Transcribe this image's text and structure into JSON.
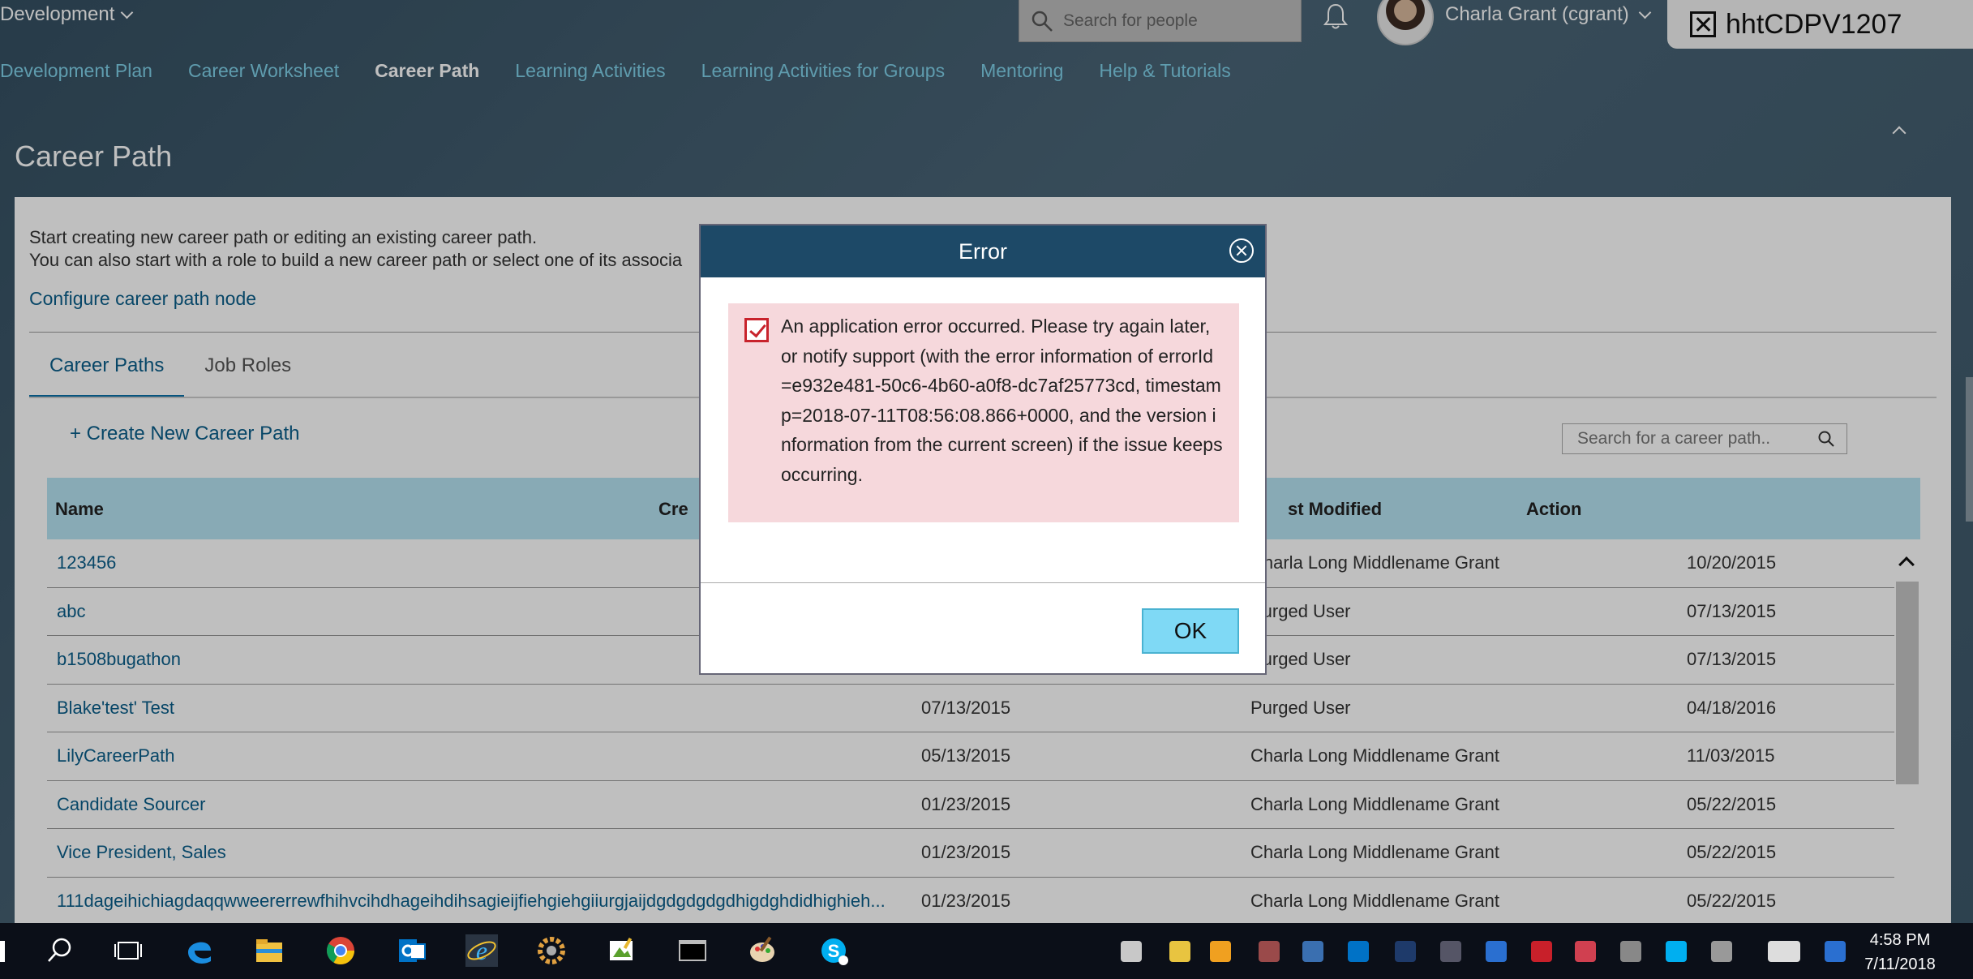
{
  "header": {
    "menu_label": "Development",
    "search_placeholder": "Search for people",
    "user_name": "Charla Grant (cgrant)",
    "window_tab_label": "hhtCDPV1207"
  },
  "nav": {
    "items": [
      "Development Plan",
      "Career Worksheet",
      "Career Path",
      "Learning Activities",
      "Learning Activities for Groups",
      "Mentoring",
      "Help & Tutorials"
    ],
    "active_item": "Career Path"
  },
  "page": {
    "title": "Career Path",
    "intro_line1": "Start creating new career path or editing an existing career path.",
    "intro_line2": "You can also start with a role to build a new career path or select one of its associa",
    "configure_link": "Configure career path node",
    "tabs": [
      "Career Paths",
      "Job Roles"
    ],
    "active_tab": "Career Paths",
    "create_button": "+ Create New Career Path",
    "search_placeholder": "Search for a career path.."
  },
  "table": {
    "headers": [
      "Name",
      "Cre",
      "st Modified",
      "Action"
    ],
    "rows": [
      {
        "name": "123456",
        "created": "",
        "modified_by": "Charla Long Middlename Grant",
        "date": "10/20/2015"
      },
      {
        "name": "abc",
        "created": "",
        "modified_by": "Purged User",
        "date": "07/13/2015"
      },
      {
        "name": "b1508bugathon",
        "created": "",
        "modified_by": "Purged User",
        "date": "07/13/2015"
      },
      {
        "name": "Blake'test' Test",
        "created": "07/13/2015",
        "modified_by": "Purged User",
        "date": "04/18/2016"
      },
      {
        "name": "LilyCareerPath",
        "created": "05/13/2015",
        "modified_by": "Charla Long Middlename Grant",
        "date": "11/03/2015"
      },
      {
        "name": "Candidate Sourcer",
        "created": "01/23/2015",
        "modified_by": "Charla Long Middlename Grant",
        "date": "05/22/2015"
      },
      {
        "name": "Vice President, Sales",
        "created": "01/23/2015",
        "modified_by": "Charla Long Middlename Grant",
        "date": "05/22/2015"
      },
      {
        "name": "111dageihichiagdaqqwweererrewfhihvcihdhageihdihsagieijfiehgiehgiiurgjaijdgdgdgdgdhigdghdidhighieh...",
        "created": "01/23/2015",
        "modified_by": "Charla Long Middlename Grant",
        "date": "05/22/2015"
      }
    ]
  },
  "dialog": {
    "title": "Error",
    "message": "An application error occurred. Please try again later, or notify support (with the error information of errorId=e932e481-50c6-4b60-a0f8-dc7af25773cd, timestamp=2018-07-11T08:56:08.866+0000, and the version information from the current screen) if the issue keeps occurring.",
    "ok_label": "OK"
  },
  "taskbar": {
    "time": "4:58 PM",
    "date": "7/11/2018",
    "icons": [
      "start-icon",
      "search-icon",
      "task-view-icon",
      "edge-icon",
      "file-explorer-icon",
      "chrome-icon",
      "outlook-icon",
      "internet-explorer-icon",
      "settings-gear-icon",
      "paint-icon",
      "terminal-icon",
      "paint-palette-icon",
      "skype-icon"
    ]
  },
  "colors": {
    "header_bg": "#3f5867",
    "nav_link": "#7fd0e8",
    "dialog_header": "#1d4967",
    "error_bg": "#f6d8dc",
    "ok_button": "#7fd9f5",
    "table_header": "#b6e3f2"
  }
}
